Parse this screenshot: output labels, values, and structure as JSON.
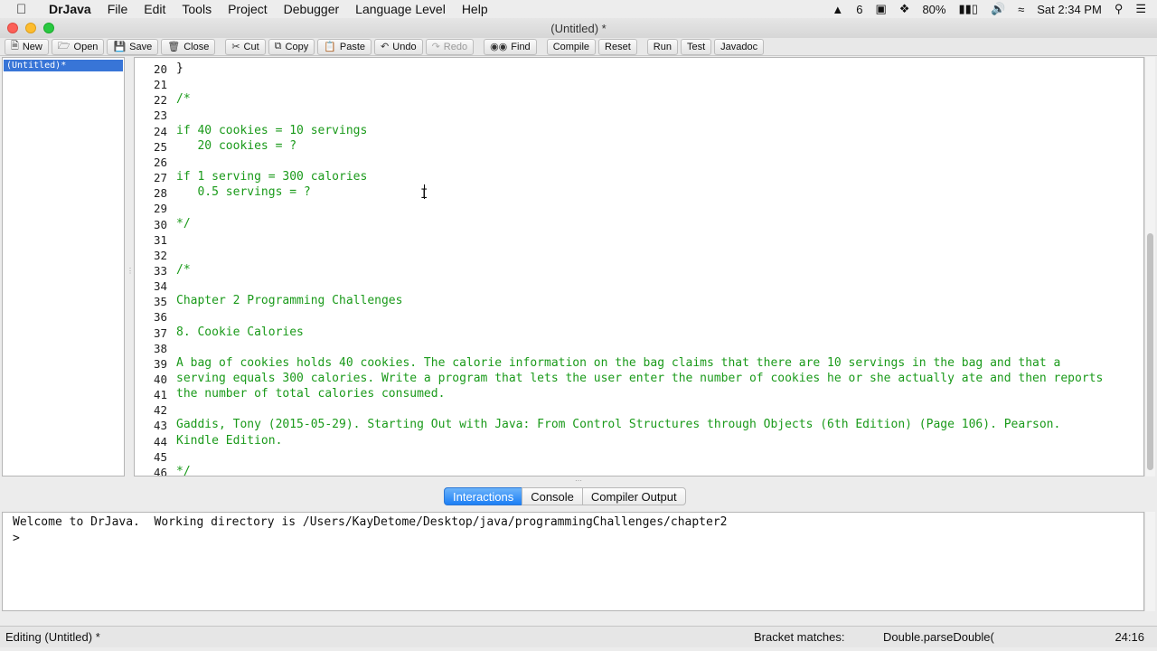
{
  "menubar": {
    "app_name": "DrJava",
    "items": [
      "File",
      "Edit",
      "Tools",
      "Project",
      "Debugger",
      "Language Level",
      "Help"
    ],
    "status": {
      "adobe_count": "6",
      "battery": "80%",
      "clock": "Sat 2:34 PM"
    }
  },
  "window": {
    "title": "(Untitled) *"
  },
  "toolbar": {
    "buttons": [
      {
        "label": "New",
        "icon": "new-file-icon"
      },
      {
        "label": "Open",
        "icon": "open-folder-icon"
      },
      {
        "label": "Save",
        "icon": "save-disk-icon"
      },
      {
        "label": "Close",
        "icon": "close-file-icon"
      },
      {
        "label": "Cut",
        "icon": "scissors-icon"
      },
      {
        "label": "Copy",
        "icon": "copy-icon"
      },
      {
        "label": "Paste",
        "icon": "paste-icon"
      },
      {
        "label": "Undo",
        "icon": "undo-icon"
      },
      {
        "label": "Redo",
        "icon": "redo-icon"
      },
      {
        "label": "Find",
        "icon": "binoculars-icon"
      },
      {
        "label": "Compile"
      },
      {
        "label": "Reset"
      },
      {
        "label": "Run"
      },
      {
        "label": "Test"
      },
      {
        "label": "Javadoc"
      }
    ]
  },
  "doclist": {
    "selected": "(Untitled)*"
  },
  "editor": {
    "lines": [
      {
        "num": "20",
        "text": "}"
      },
      {
        "num": "21",
        "text": ""
      },
      {
        "num": "22",
        "text": "/*"
      },
      {
        "num": "23",
        "text": ""
      },
      {
        "num": "24",
        "text": "if 40 cookies = 10 servings"
      },
      {
        "num": "25",
        "text": "   20 cookies = ?"
      },
      {
        "num": "26",
        "text": ""
      },
      {
        "num": "27",
        "text": "if 1 serving = 300 calories"
      },
      {
        "num": "28",
        "text": "   0.5 servings = ?"
      },
      {
        "num": "29",
        "text": ""
      },
      {
        "num": "30",
        "text": "*/"
      },
      {
        "num": "31",
        "text": ""
      },
      {
        "num": "32",
        "text": ""
      },
      {
        "num": "33",
        "text": "/*"
      },
      {
        "num": "34",
        "text": ""
      },
      {
        "num": "35",
        "text": "Chapter 2 Programming Challenges"
      },
      {
        "num": "36",
        "text": ""
      },
      {
        "num": "37",
        "text": "8. Cookie Calories"
      },
      {
        "num": "38",
        "text": ""
      },
      {
        "num": "39",
        "text": "A bag of cookies holds 40 cookies. The calorie information on the bag claims that there are 10 servings in the bag and that a"
      },
      {
        "num": "40",
        "text": "serving equals 300 calories. Write a program that lets the user enter the number of cookies he or she actually ate and then reports"
      },
      {
        "num": "41",
        "text": "the number of total calories consumed."
      },
      {
        "num": "42",
        "text": ""
      },
      {
        "num": "43",
        "text": "Gaddis, Tony (2015-05-29). Starting Out with Java: From Control Structures through Objects (6th Edition) (Page 106). Pearson."
      },
      {
        "num": "44",
        "text": "Kindle Edition."
      },
      {
        "num": "45",
        "text": ""
      },
      {
        "num": "46",
        "text": "*/"
      }
    ]
  },
  "tabs": [
    "Interactions",
    "Console",
    "Compiler Output"
  ],
  "interactions": {
    "welcome": "Welcome to DrJava.  Working directory is /Users/KayDetome/Desktop/java/programmingChallenges/chapter2",
    "prompt": ">"
  },
  "statusbar": {
    "editing": "Editing (Untitled) *",
    "bracket_label": "Bracket matches:",
    "bracket_value": "Double.parseDouble(",
    "position": "24:16"
  },
  "colors": {
    "comment": "#1a9a1a",
    "selection": "#3875d7",
    "active_tab": "#1c7ff5"
  }
}
